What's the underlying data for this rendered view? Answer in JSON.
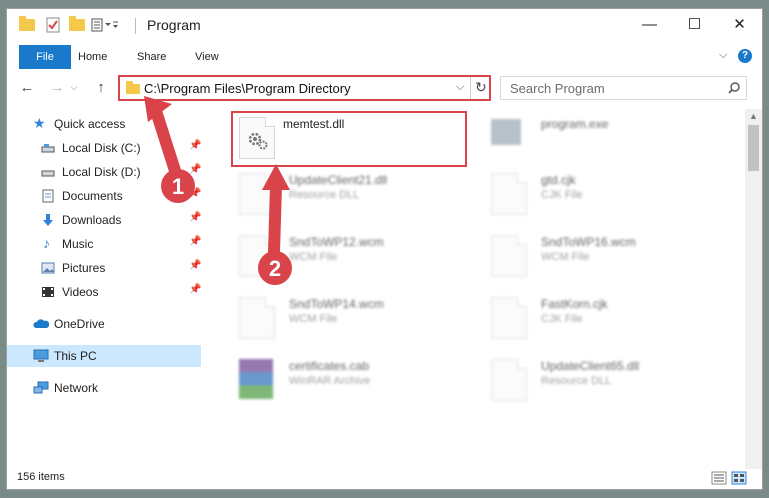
{
  "window": {
    "title": "Program",
    "controls": {
      "minimize": "—",
      "maximize": "☐",
      "close": "✕"
    }
  },
  "ribbon": {
    "tabs": [
      "File",
      "Home",
      "Share",
      "View"
    ],
    "help": "?"
  },
  "navigation": {
    "address": "C:\\Program Files\\Program Directory",
    "search_placeholder": "Search Program"
  },
  "sidebar": {
    "items": [
      {
        "label": "Quick access",
        "icon": "star-icon"
      },
      {
        "label": "Local Disk (C:)",
        "icon": "drive-icon",
        "pinned": true
      },
      {
        "label": "Local Disk (D:)",
        "icon": "drive-icon",
        "pinned": true
      },
      {
        "label": "Documents",
        "icon": "documents-icon",
        "pinned": true
      },
      {
        "label": "Downloads",
        "icon": "download-icon",
        "pinned": true
      },
      {
        "label": "Music",
        "icon": "music-icon",
        "pinned": true
      },
      {
        "label": "Pictures",
        "icon": "pictures-icon",
        "pinned": true
      },
      {
        "label": "Videos",
        "icon": "videos-icon",
        "pinned": true
      },
      {
        "label": "OneDrive",
        "icon": "cloud-icon"
      },
      {
        "label": "This PC",
        "icon": "computer-icon",
        "selected": true
      },
      {
        "label": "Network",
        "icon": "network-icon"
      }
    ]
  },
  "files": [
    {
      "name": "memtest.dll",
      "type": ""
    },
    {
      "name": "program.exe",
      "type": ""
    },
    {
      "name": "UpdateClient21.dll",
      "type": "Resource DLL"
    },
    {
      "name": "gtd.cjk",
      "type": "CJK File"
    },
    {
      "name": "SndToWP12.wcm",
      "type": "WCM File"
    },
    {
      "name": "SndToWP16.wcm",
      "type": "WCM File"
    },
    {
      "name": "SndToWP14.wcm",
      "type": "WCM File"
    },
    {
      "name": "FastKorn.cjk",
      "type": "CJK File"
    },
    {
      "name": "certificates.cab",
      "type": "WinRAR Archive"
    },
    {
      "name": "UpdateClient65.dll",
      "type": "Resource DLL"
    }
  ],
  "status": {
    "item_count": "156 items"
  },
  "annotations": {
    "step1": "1",
    "step2": "2",
    "color": "#d9444b"
  }
}
